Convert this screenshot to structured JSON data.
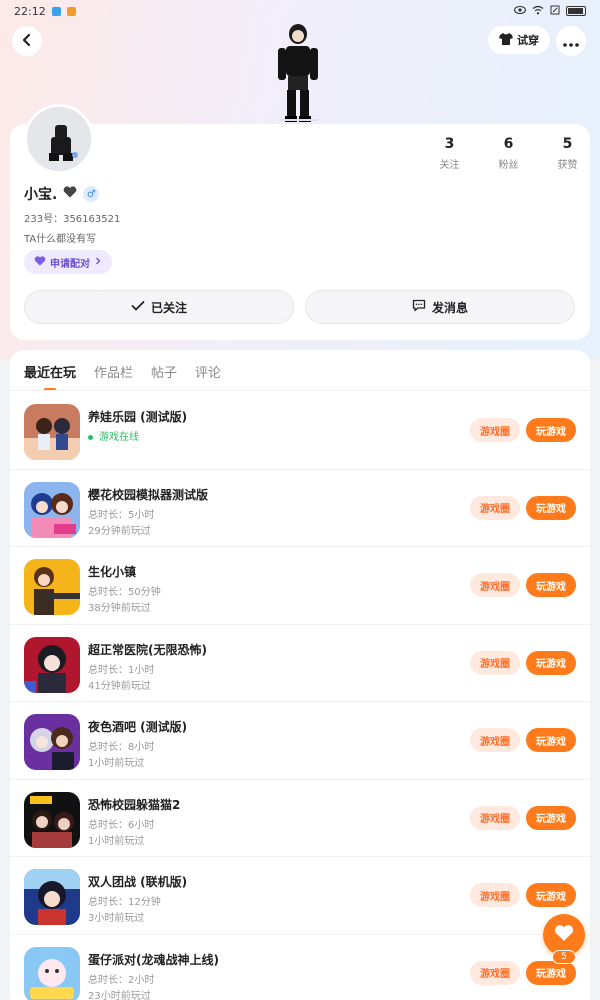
{
  "status_bar": {
    "time": "22:12"
  },
  "header": {
    "tryon_label": "试穿"
  },
  "profile": {
    "stats": [
      {
        "num": "3",
        "label": "关注"
      },
      {
        "num": "6",
        "label": "粉丝"
      },
      {
        "num": "5",
        "label": "获赞"
      }
    ],
    "username": "小宝.",
    "uid": "233号：356163521",
    "bio": "TA什么都没有写",
    "pair_label": "申请配对",
    "follow_label": "已关注",
    "message_label": "发消息"
  },
  "tabs": [
    "最近在玩",
    "作品栏",
    "帖子",
    "评论"
  ],
  "games": [
    {
      "title": "养娃乐园 (测试版)",
      "line2": "游戏在线",
      "line3": "",
      "online": true,
      "colors": [
        "#b5654a",
        "#f3c7a5"
      ]
    },
    {
      "title": "樱花校园模拟器测试版",
      "line2": "总时长：5小时",
      "line3": "29分钟前玩过",
      "online": false,
      "colors": [
        "#3d6fd6",
        "#f28bb5"
      ]
    },
    {
      "title": "生化小镇",
      "line2": "总时长：50分钟",
      "line3": "38分钟前玩过",
      "online": false,
      "colors": [
        "#f5b41a",
        "#7a4a2a"
      ]
    },
    {
      "title": "超正常医院(无限恐怖)",
      "line2": "总时长：1小时",
      "line3": "41分钟前玩过",
      "online": false,
      "colors": [
        "#b0172e",
        "#2a2a3a"
      ]
    },
    {
      "title": "夜色酒吧 (测试版)",
      "line2": "总时长：8小时",
      "line3": "1小时前玩过",
      "online": false,
      "colors": [
        "#6a2fa0",
        "#d6d3e6"
      ]
    },
    {
      "title": "恐怖校园躲猫猫2",
      "line2": "总时长：6小时",
      "line3": "1小时前玩过",
      "online": false,
      "colors": [
        "#111111",
        "#a63b3b"
      ]
    },
    {
      "title": "双人团战 (联机版)",
      "line2": "总时长：12分钟",
      "line3": "3小时前玩过",
      "online": false,
      "colors": [
        "#1f3a8a",
        "#9fd2f2"
      ]
    },
    {
      "title": "蛋仔派对(龙魂战神上线)",
      "line2": "总时长：2小时",
      "line3": "23小时前玩过",
      "online": false,
      "colors": [
        "#89c8f5",
        "#ffd84d"
      ]
    }
  ],
  "game_buttons": {
    "circle_label": "游戏圈",
    "play_label": "玩游戏"
  },
  "fab": {
    "count": "5"
  }
}
